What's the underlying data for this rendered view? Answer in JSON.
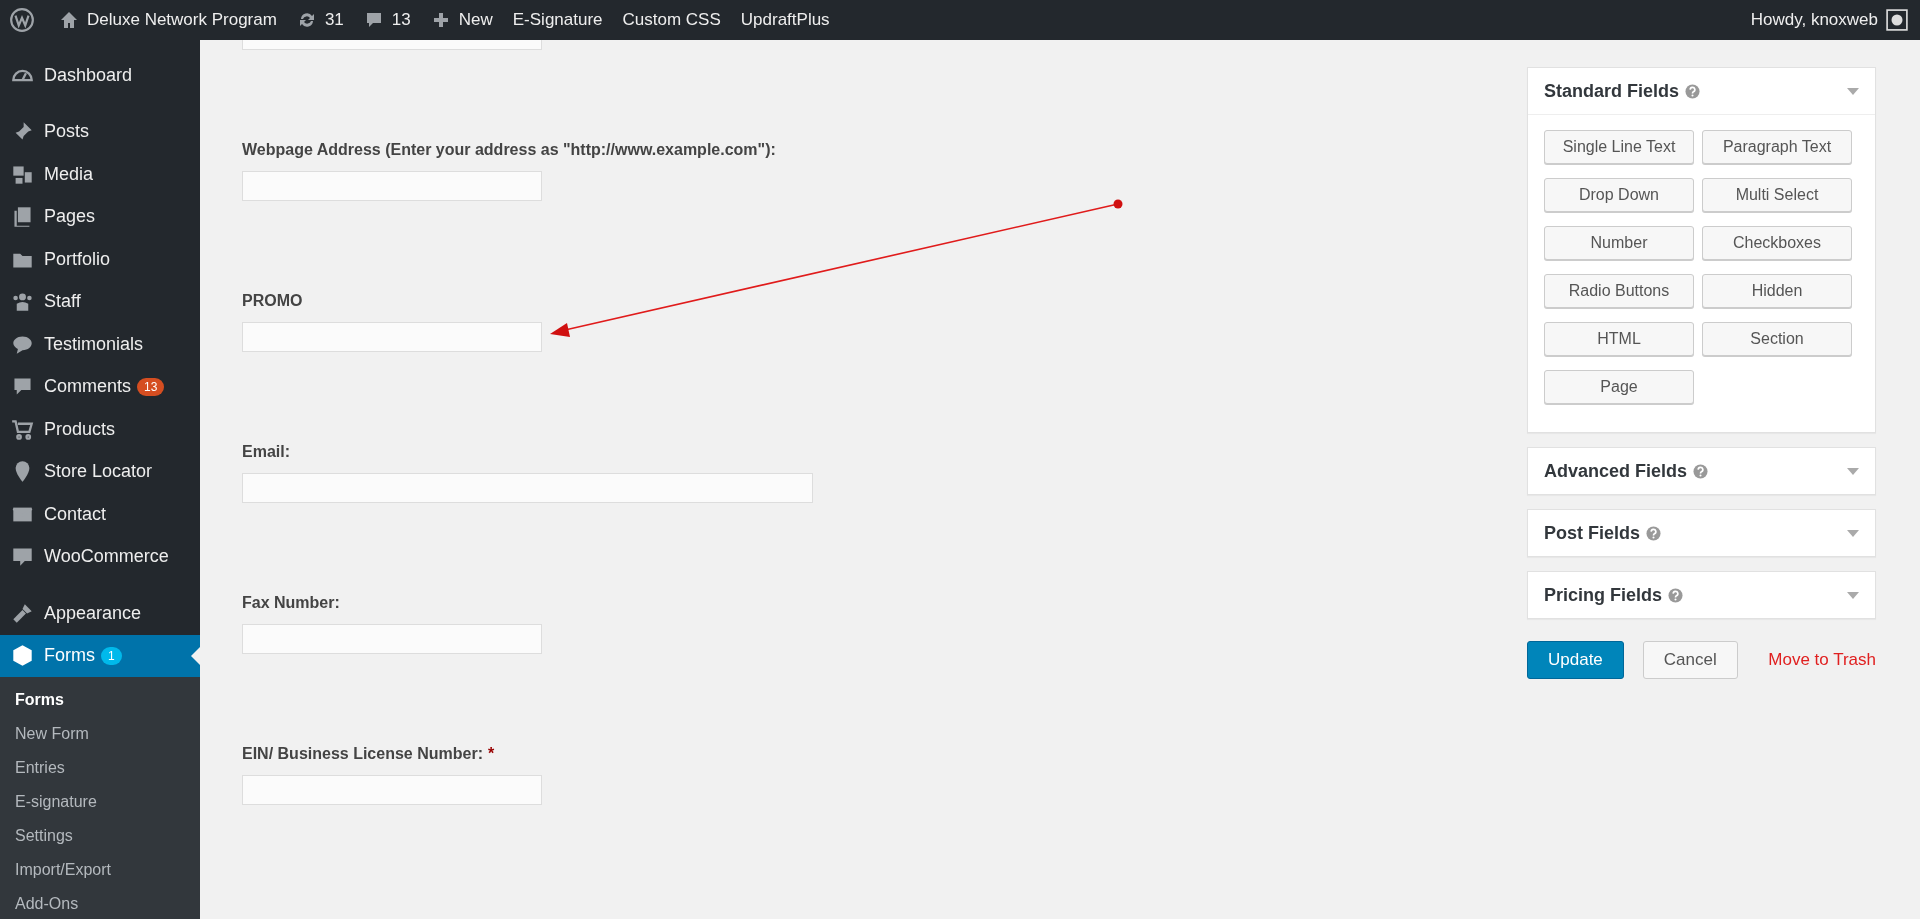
{
  "admin_bar": {
    "items": [
      {
        "kind": "logo"
      },
      {
        "kind": "home",
        "label": "Deluxe Network Program"
      },
      {
        "kind": "updates",
        "label": "31"
      },
      {
        "kind": "comments",
        "label": "13"
      },
      {
        "kind": "new",
        "label": "New"
      },
      {
        "kind": "link",
        "label": "E-Signature"
      },
      {
        "kind": "link",
        "label": "Custom CSS"
      },
      {
        "kind": "link",
        "label": "UpdraftPlus"
      }
    ],
    "account": "Howdy, knoxweb"
  },
  "sidebar": {
    "groups": [
      [
        {
          "kind": "dashboard",
          "label": "Dashboard",
          "selected": false
        }
      ],
      [
        {
          "kind": "posts",
          "label": "Posts",
          "selected": false
        },
        {
          "kind": "media",
          "label": "Media",
          "selected": false
        },
        {
          "kind": "pages",
          "label": "Pages",
          "selected": false
        },
        {
          "kind": "portfolio",
          "label": "Portfolio",
          "selected": false
        },
        {
          "kind": "staff",
          "label": "Staff",
          "selected": false
        },
        {
          "kind": "testimonials",
          "label": "Testimonials",
          "selected": false
        },
        {
          "kind": "comments",
          "label": "Comments",
          "badge": "13",
          "selected": false
        },
        {
          "kind": "products",
          "label": "Products",
          "selected": false
        },
        {
          "kind": "location",
          "label": "Store Locator",
          "selected": false
        },
        {
          "kind": "contact",
          "label": "Contact",
          "selected": false
        },
        {
          "kind": "woo",
          "label": "WooCommerce",
          "selected": false
        }
      ],
      [
        {
          "kind": "appearance",
          "label": "Appearance",
          "selected": false
        },
        {
          "kind": "forms",
          "label": "Forms",
          "badge": "1",
          "selected": true
        }
      ]
    ],
    "submenu": [
      {
        "label": "Forms",
        "selected": true
      },
      {
        "label": "New Form",
        "selected": false
      },
      {
        "label": "Entries",
        "selected": false
      },
      {
        "label": "E-signature",
        "selected": false
      },
      {
        "label": "Settings",
        "selected": false
      },
      {
        "label": "Import/Export",
        "selected": false
      },
      {
        "label": "Add-Ons",
        "selected": false
      }
    ]
  },
  "form_fields": [
    {
      "kind": "short"
    },
    {
      "kind": "short",
      "label": "Webpage Address (Enter your address as \"http://www.example.com\"):"
    },
    {
      "kind": "short",
      "label": "PROMO"
    },
    {
      "kind": "wide",
      "label": "Email:"
    },
    {
      "kind": "short",
      "label": "Fax Number:"
    },
    {
      "kind": "short",
      "label": "EIN/ Business License Number:",
      "required_mark": "*"
    }
  ],
  "field_panels": [
    {
      "title": "Standard Fields",
      "expanded": true,
      "buttons": [
        "Single Line Text",
        "Paragraph Text",
        "Drop Down",
        "Multi Select",
        "Number",
        "Checkboxes",
        "Radio Buttons",
        "Hidden",
        "HTML",
        "Section",
        "Page"
      ]
    },
    {
      "title": "Advanced Fields",
      "expanded": false
    },
    {
      "title": "Post Fields",
      "expanded": false
    },
    {
      "title": "Pricing Fields",
      "expanded": false
    }
  ],
  "actions": {
    "update": "Update",
    "cancel": "Cancel",
    "trash": "Move to Trash"
  }
}
